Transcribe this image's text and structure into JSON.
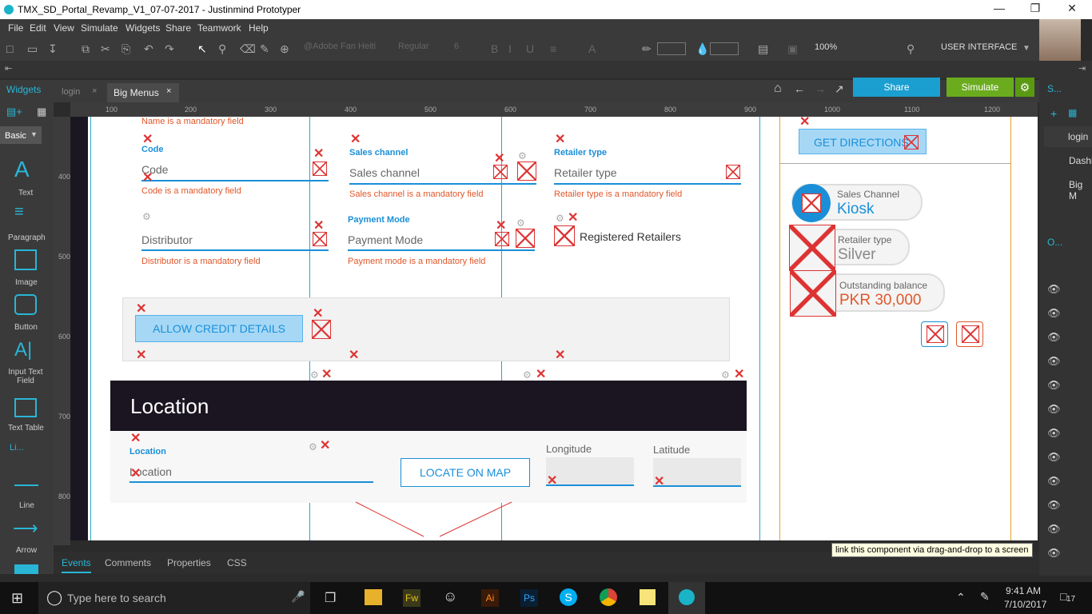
{
  "window": {
    "title": "TMX_SD_Portal_Revamp_V1_07-07-2017 - Justinmind Prototyper"
  },
  "menu": [
    "File",
    "Edit",
    "View",
    "Simulate",
    "Widgets",
    "Share",
    "Teamwork",
    "Help"
  ],
  "toolbar": {
    "font": "@Adobe Fan Heiti",
    "weight": "Regular",
    "size": "6",
    "zoom": "100%",
    "mode": "USER INTERFACE"
  },
  "tabs": {
    "widgets": "Widgets",
    "login": "login",
    "big_menus": "Big Menus"
  },
  "actions": {
    "share": "Share",
    "simulate": "Simulate"
  },
  "left_panel": {
    "basic": "Basic",
    "items": [
      "Text",
      "Paragraph",
      "Image",
      "Button",
      "Input Text Field",
      "Text Table",
      "Li...",
      "Line",
      "Arrow"
    ]
  },
  "ruler": {
    "h": [
      "100",
      "200",
      "300",
      "400",
      "500",
      "600",
      "700",
      "800",
      "900",
      "1000",
      "1100",
      "1200"
    ],
    "v": [
      "400",
      "500",
      "600",
      "700",
      "800"
    ]
  },
  "form": {
    "name_err": "Name is a mandatory field",
    "code_label": "Code",
    "code_ph": "Code",
    "code_err": "Code is a mandatory field",
    "sales_label": "Sales channel",
    "sales_ph": "Sales channel",
    "sales_err": "Sales channel is a mandatory field",
    "retailer_label": "Retailer type",
    "retailer_ph": "Retailer type",
    "retailer_err": "Retailer type is a mandatory field",
    "dist_ph": "Distributor",
    "dist_err": "Distributor is a mandatory field",
    "pay_label": "Payment Mode",
    "pay_ph": "Payment Mode",
    "pay_err": "Payment mode is a mandatory field",
    "registered": "Registered Retailers",
    "allow_credit": "ALLOW CREDIT DETAILS",
    "location_header": "Location",
    "loc_label": "Location",
    "loc_ph": "Location",
    "locate_btn": "LOCATE ON MAP",
    "longitude": "Longitude",
    "latitude": "Latitude"
  },
  "side_card": {
    "get_directions": "GET DIRECTIONS",
    "sales_channel_label": "Sales Channel",
    "sales_channel_value": "Kiosk",
    "retailer_type_label": "Retailer type",
    "retailer_type_value": "Silver",
    "balance_label": "Outstanding balance",
    "balance_value": "PKR 30,000"
  },
  "right_panel": {
    "s": "S...",
    "pages": [
      "login",
      "Dashb",
      "Big M"
    ],
    "o": "O..."
  },
  "bottom_tabs": [
    "Events",
    "Comments",
    "Properties",
    "CSS"
  ],
  "tooltip": "link this component via drag-and-drop to a screen",
  "taskbar": {
    "search": "Type here to search",
    "time": "9:41 AM",
    "date": "7/10/2017",
    "notif": "17"
  }
}
